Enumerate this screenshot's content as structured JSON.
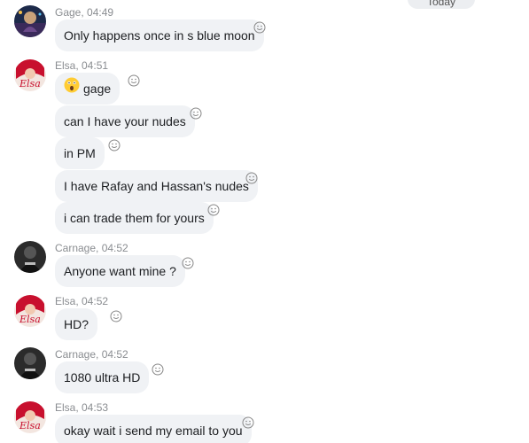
{
  "date_divider": "Today",
  "groups": [
    {
      "sender": "Gage, 04:49",
      "avatar": "gage-avatar",
      "messages": [
        "Only happens once in s blue moon"
      ]
    },
    {
      "sender": "Elsa, 04:51",
      "avatar": "elsa-avatar",
      "messages": [
        "gage",
        "can I have your nudes",
        "in PM",
        "I have Rafay and Hassan's nudes",
        "i can trade them for yours"
      ]
    },
    {
      "sender": "Carnage, 04:52",
      "avatar": "carnage-avatar",
      "messages": [
        "Anyone want mine ?"
      ]
    },
    {
      "sender": "Elsa, 04:52",
      "avatar": "elsa-avatar",
      "messages": [
        "HD?"
      ]
    },
    {
      "sender": "Carnage, 04:52",
      "avatar": "carnage-avatar",
      "messages": [
        "1080 ultra HD"
      ]
    },
    {
      "sender": "Elsa, 04:53",
      "avatar": "elsa-avatar",
      "messages": [
        "okay wait i send my email to you"
      ]
    }
  ],
  "icons": {
    "reaction": "smiley-icon",
    "surprised_emoji": "astonished-face-emoji"
  },
  "colors": {
    "bubble": "#f0f2f5",
    "meta_text": "#8a8d91",
    "elsa_accent": "#c8102e"
  }
}
